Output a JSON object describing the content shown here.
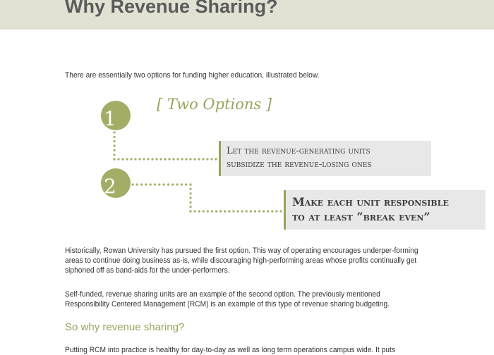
{
  "header": {
    "title": "Why Revenue Sharing?"
  },
  "intro": "There are essentially two options for funding higher education, illustrated below.",
  "diagram": {
    "title": "[ Two Options ]",
    "option1": {
      "number": "1",
      "line1": "Let the revenue-generating units",
      "line2": "subsidize the revenue-losing ones"
    },
    "option2": {
      "number": "2",
      "line1": "Make each unit responsible",
      "line2": "to at least “break even”"
    },
    "accent_color": "#a4ad66"
  },
  "paragraphs": {
    "p1": "Historically, Rowan University has pursued the first option. This way of operating encourages underper-forming areas to continue doing business as-is, while discouraging high-performing areas whose profits continually get siphoned off as band-aids for the under-performers.",
    "p2": "Self-funded, revenue sharing units are an example of the second option.  The previously mentioned Responsibility Centered Management (RCM) is an example of this type of revenue sharing budgeting.",
    "subhead": "So why revenue sharing?",
    "p3": "Putting RCM into practice is healthy for day-to-day as well as long term operations campus wide. It puts"
  }
}
